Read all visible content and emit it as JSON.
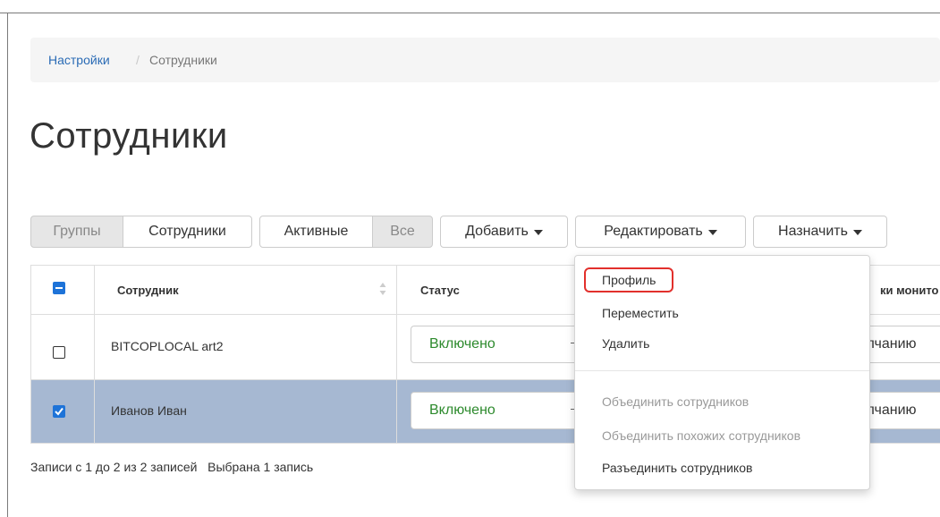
{
  "breadcrumb": {
    "link": "Настройки",
    "separator": "/",
    "current": "Сотрудники"
  },
  "page_title": "Сотрудники",
  "toolbar": {
    "groups": "Группы",
    "employees": "Сотрудники",
    "active": "Активные",
    "all": "Все",
    "add": "Добавить",
    "edit": "Редактировать",
    "assign": "Назначить"
  },
  "table": {
    "headers": {
      "employee": "Сотрудник",
      "status": "Статус",
      "monitoring_partial": "ки монито"
    },
    "rows": [
      {
        "name": "BITCOPLOCAL art2",
        "status": "Включено",
        "default_partial": "олчанию",
        "checked": false
      },
      {
        "name": "Иванов Иван",
        "status": "Включено",
        "default_partial": "олчанию",
        "checked": true
      }
    ]
  },
  "footer": {
    "records": "Записи с 1 до 2 из 2 записей",
    "selected": "Выбрана 1 запись"
  },
  "edit_menu": {
    "profile": "Профиль",
    "move": "Переместить",
    "delete": "Удалить",
    "merge": "Объединить сотрудников",
    "merge_similar": "Объединить похожих сотрудников",
    "unmerge": "Разъединить сотрудников"
  },
  "colors": {
    "accent": "#1e73d8",
    "selected_row": "#a6b8d2",
    "status_green": "#2d8a2d",
    "highlight_red": "#e2302c"
  },
  "icons": [
    "checkbox-mixed-icon",
    "checkbox-empty-icon",
    "checkbox-checked-icon",
    "sort-icon",
    "caret-down-icon"
  ]
}
